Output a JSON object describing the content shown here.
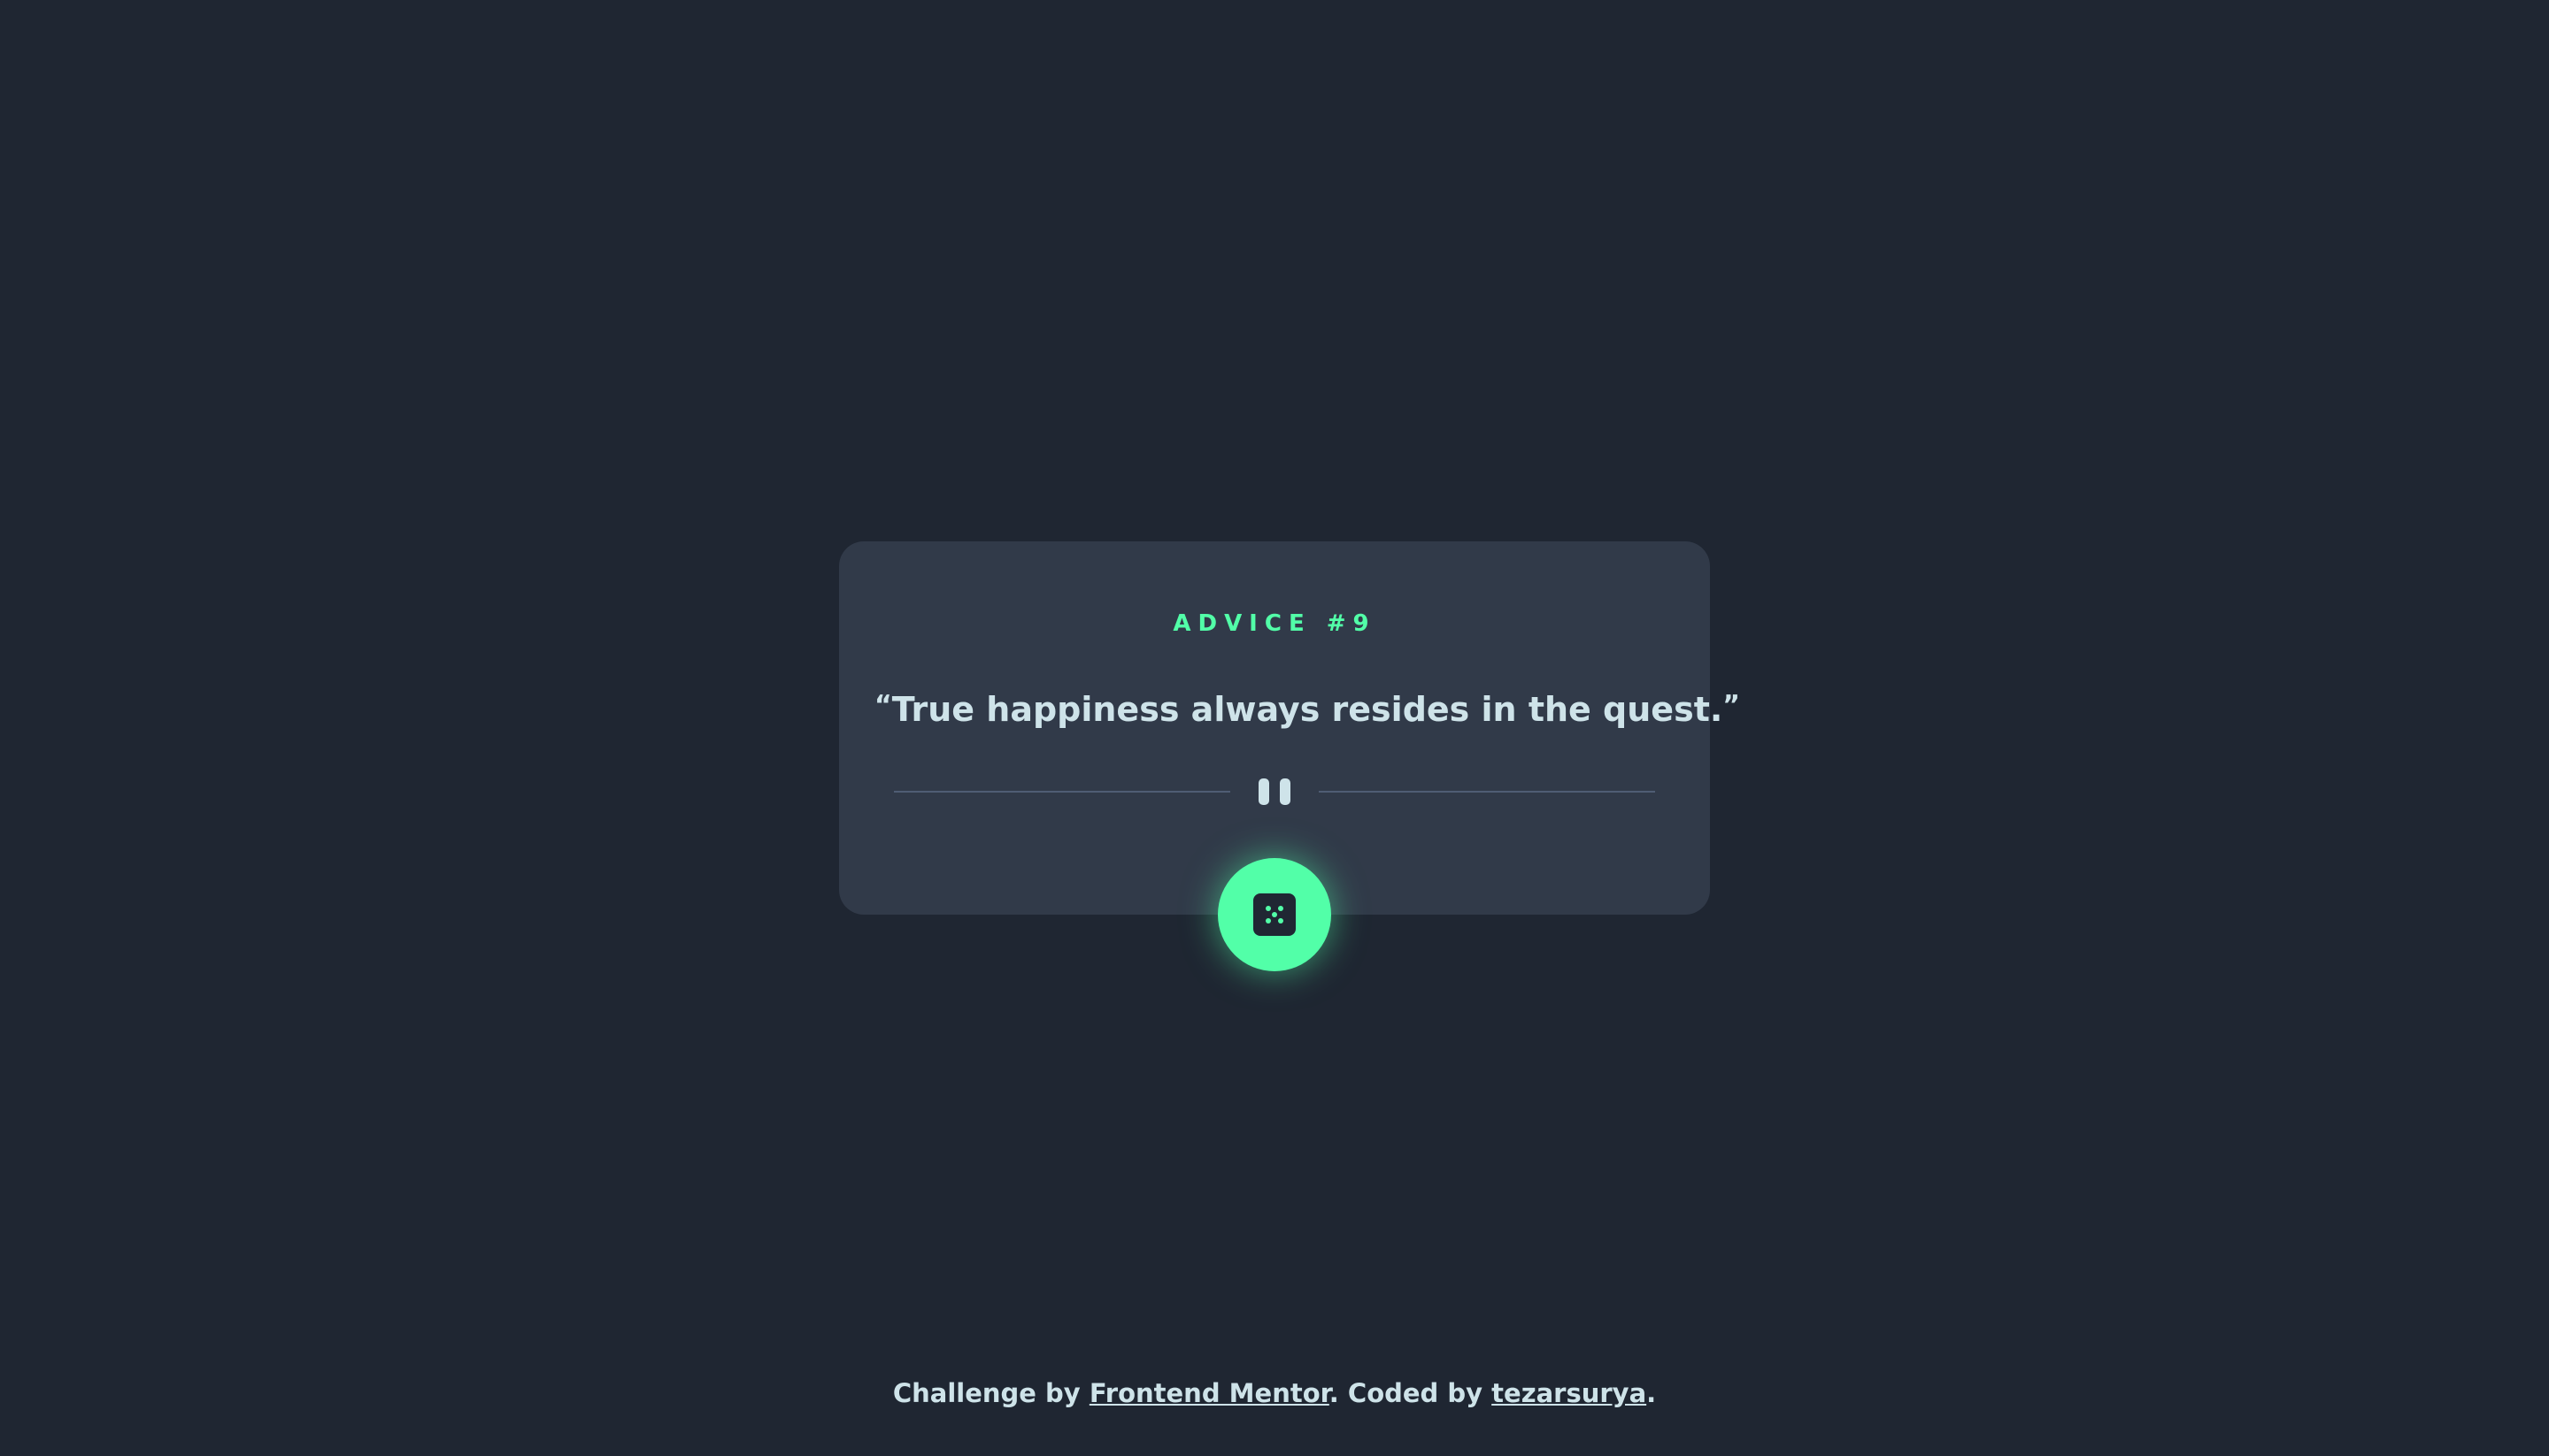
{
  "card": {
    "heading": "ADVICE #9",
    "open_quote": "“",
    "text": "True happiness always resides in the quest.",
    "close_quote": "”"
  },
  "divider": {
    "icon": "pause-icon"
  },
  "dice_button": {
    "icon": "dice-icon"
  },
  "footer": {
    "prefix": "Challenge by ",
    "challenge_link": "Frontend Mentor",
    "middle": ". Coded by ",
    "author_link": "tezarsurya",
    "suffix": "."
  },
  "colors": {
    "background": "#1f2632",
    "card": "#313a49",
    "accent": "#52ffa8",
    "text": "#cee3e9",
    "divider": "#4f5d74"
  }
}
